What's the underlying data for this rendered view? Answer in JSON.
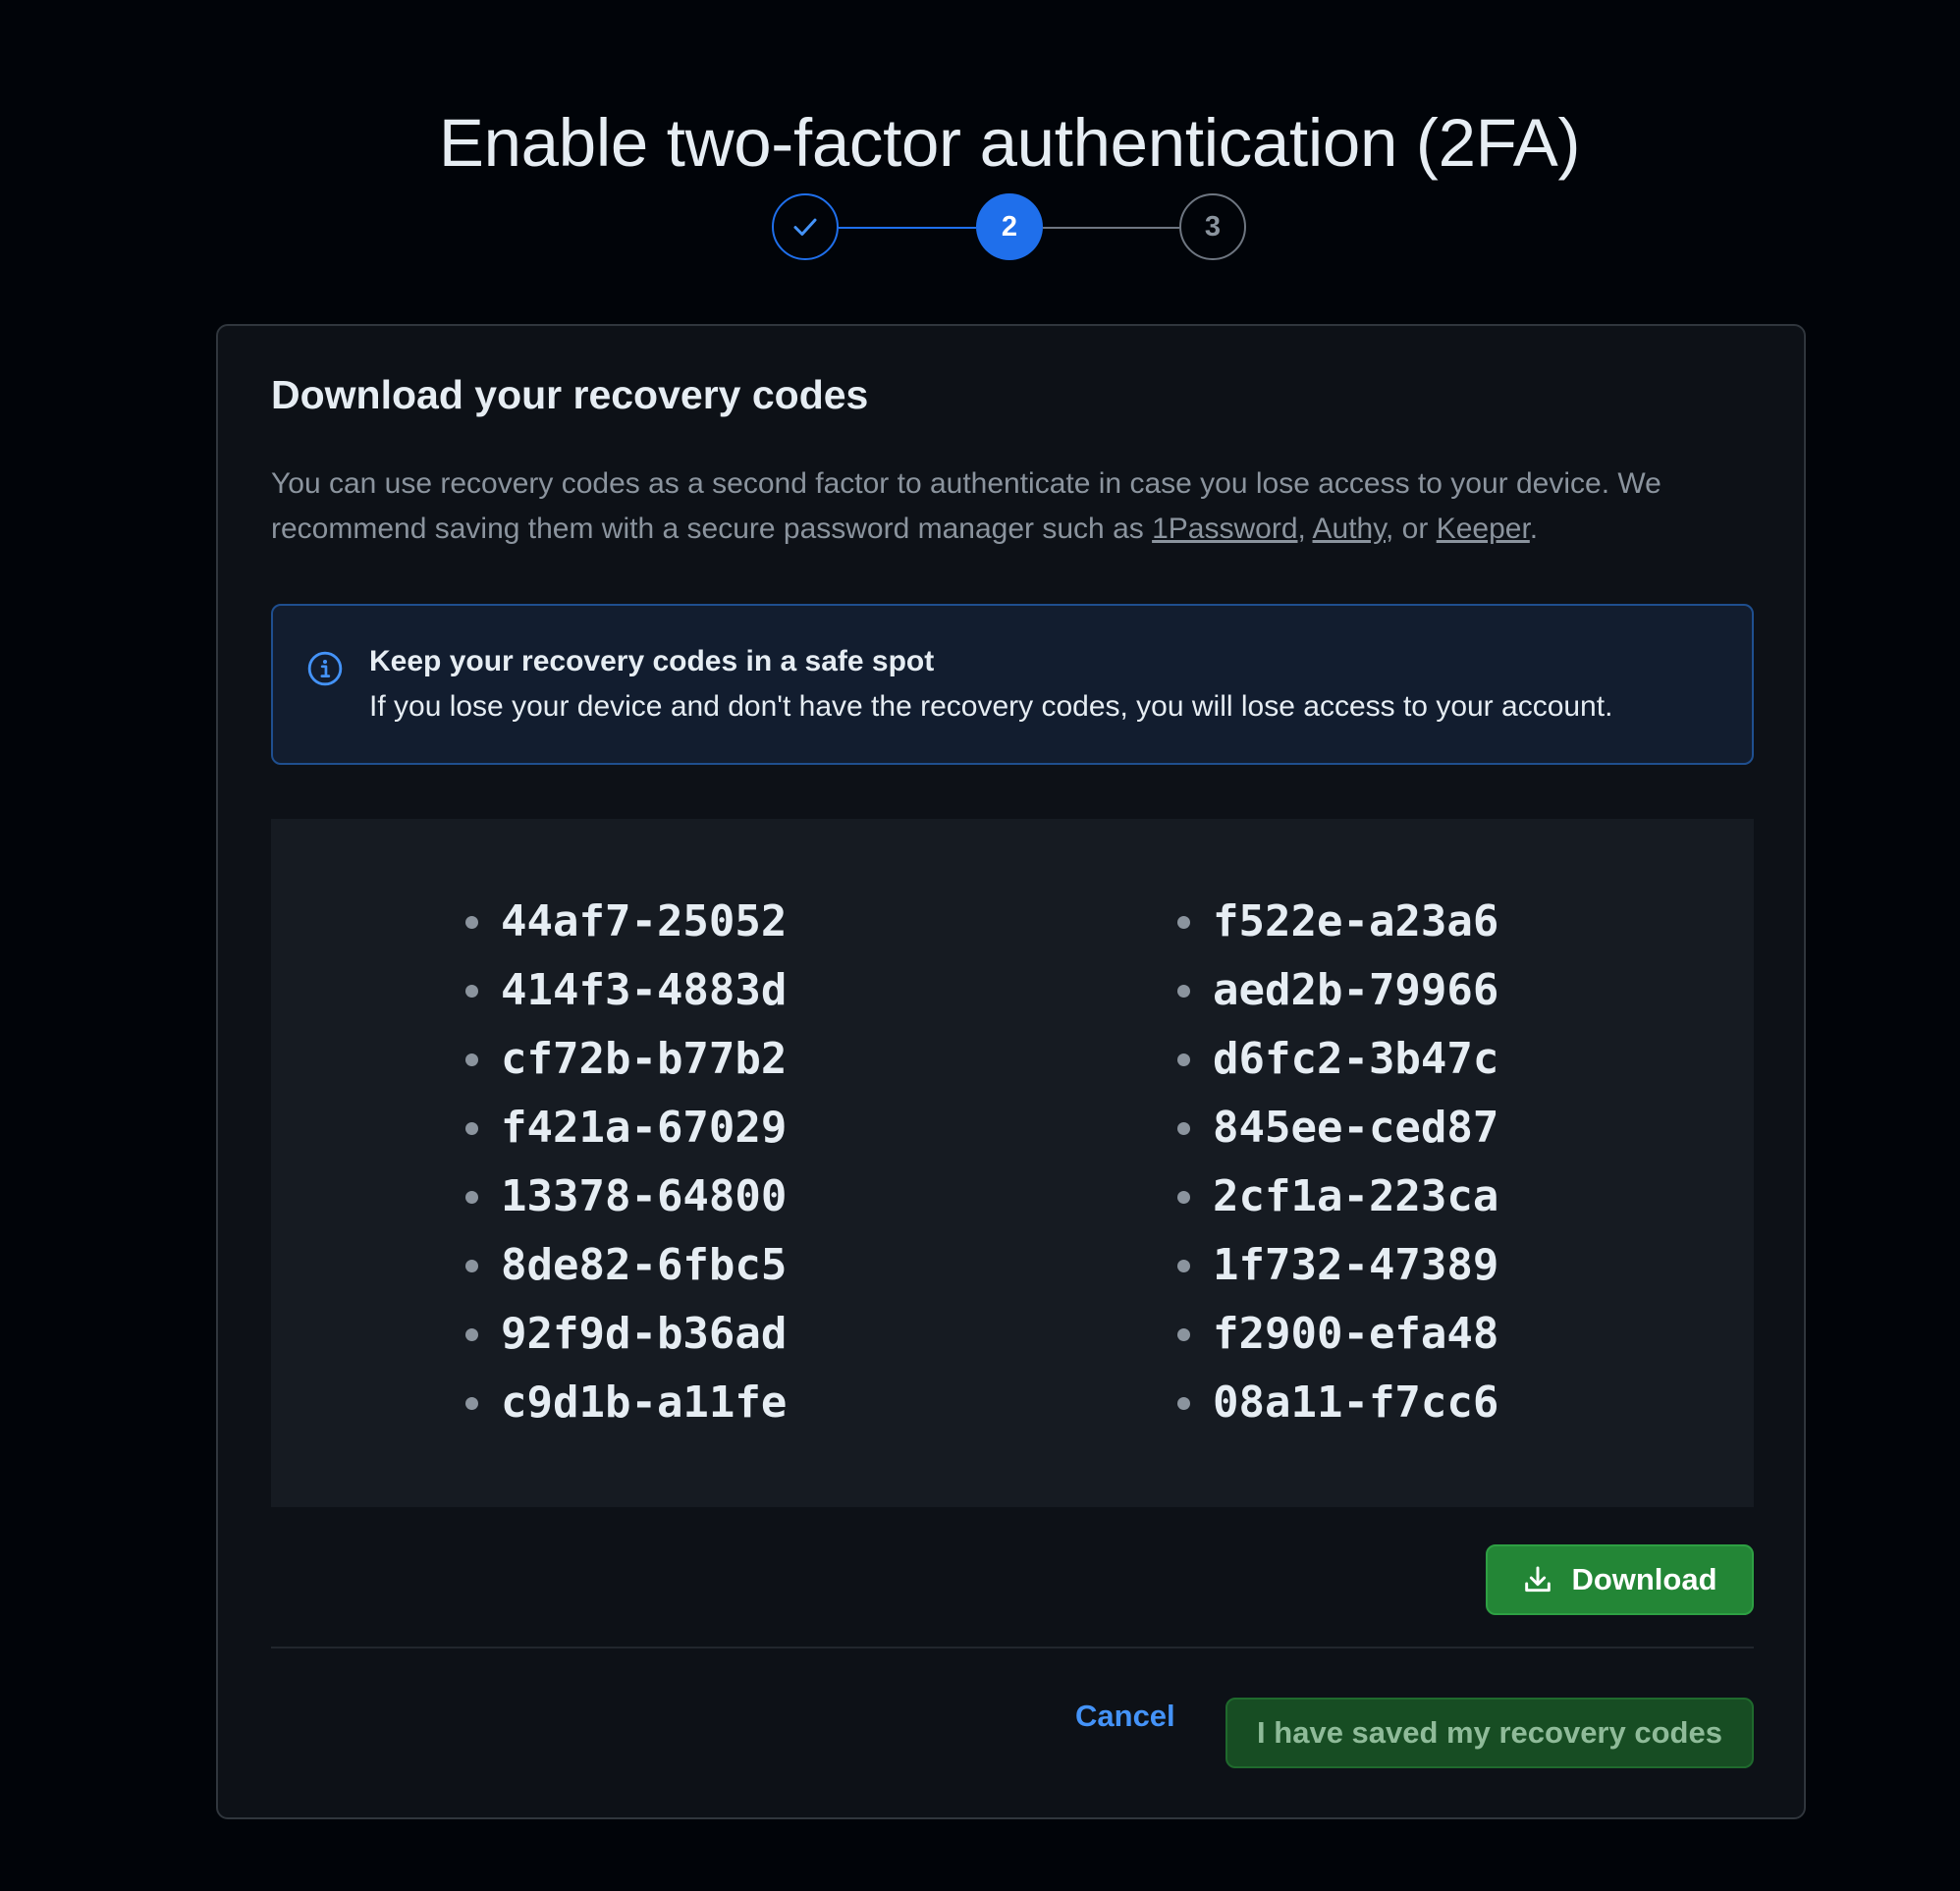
{
  "page": {
    "title": "Enable two-factor authentication (2FA)"
  },
  "stepper": {
    "steps": [
      {
        "state": "completed",
        "label": "",
        "icon": "check-icon"
      },
      {
        "state": "current",
        "label": "2"
      },
      {
        "state": "upcoming",
        "label": "3"
      }
    ],
    "current_step": 2,
    "total_steps": 3
  },
  "card": {
    "title": "Download your recovery codes",
    "description_prefix": "You can use recovery codes as a second factor to authenticate in case you lose access to your device. We recommend saving them with a secure password manager such as ",
    "links": [
      "1Password",
      "Authy",
      "Keeper"
    ],
    "sep_1": ", ",
    "sep_2": ", or ",
    "description_suffix": "."
  },
  "alert": {
    "icon": "info-icon",
    "title": "Keep your recovery codes in a safe spot",
    "body": "If you lose your device and don't have the recovery codes, you will lose access to your account."
  },
  "codes": {
    "left": [
      "44af7-25052",
      "414f3-4883d",
      "cf72b-b77b2",
      "f421a-67029",
      "13378-64800",
      "8de82-6fbc5",
      "92f9d-b36ad",
      "c9d1b-a11fe"
    ],
    "right": [
      "f522e-a23a6",
      "aed2b-79966",
      "d6fc2-3b47c",
      "845ee-ced87",
      "2cf1a-223ca",
      "1f732-47389",
      "f2900-efa48",
      "08a11-f7cc6"
    ]
  },
  "actions": {
    "download_label": "Download",
    "download_icon": "download-icon",
    "cancel_label": "Cancel",
    "confirm_label": "I have saved my recovery codes"
  },
  "colors": {
    "background": "#010409",
    "card": "#0d1117",
    "accent_blue": "#1f6feb",
    "primary_green": "#238636"
  }
}
